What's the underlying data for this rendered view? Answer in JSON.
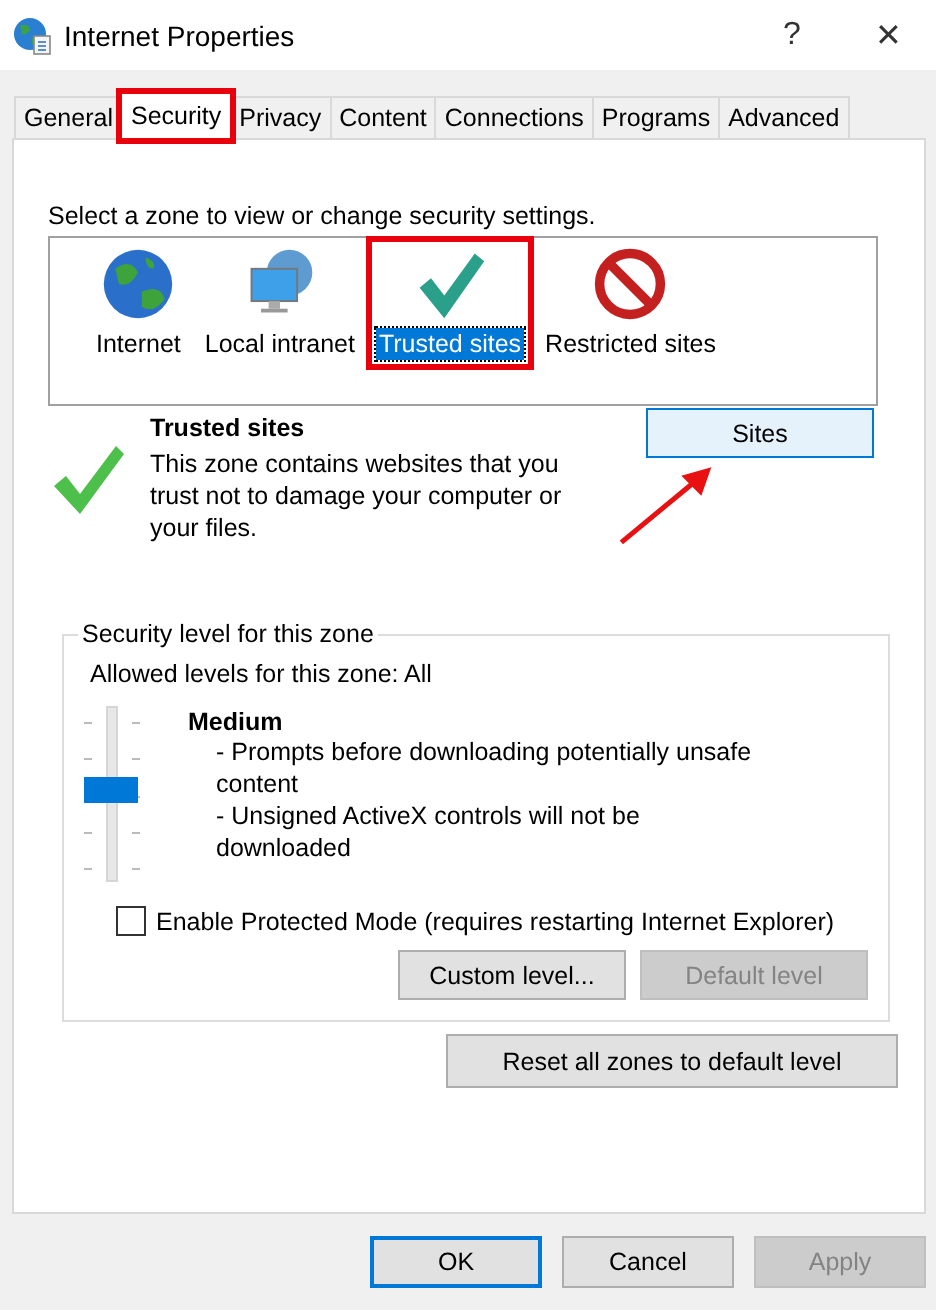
{
  "window": {
    "title": "Internet Properties",
    "help": "?",
    "close": "✕"
  },
  "tabs": [
    {
      "label": "General",
      "selected": false,
      "highlighted": false
    },
    {
      "label": "Security",
      "selected": true,
      "highlighted": true
    },
    {
      "label": "Privacy",
      "selected": false,
      "highlighted": false
    },
    {
      "label": "Content",
      "selected": false,
      "highlighted": false
    },
    {
      "label": "Connections",
      "selected": false,
      "highlighted": false
    },
    {
      "label": "Programs",
      "selected": false,
      "highlighted": false
    },
    {
      "label": "Advanced",
      "selected": false,
      "highlighted": false
    }
  ],
  "zone_prompt": "Select a zone to view or change security settings.",
  "zones": [
    {
      "kind": "globe",
      "label": "Internet",
      "selected": false,
      "highlighted": false
    },
    {
      "kind": "intranet",
      "label": "Local intranet",
      "selected": false,
      "highlighted": false
    },
    {
      "kind": "trusted",
      "label": "Trusted sites",
      "selected": true,
      "highlighted": true
    },
    {
      "kind": "restricted",
      "label": "Restricted sites",
      "selected": false,
      "highlighted": false
    }
  ],
  "zone_info": {
    "title": "Trusted sites",
    "description": "This zone contains websites that you trust not to damage your computer or your files.",
    "button": "Sites",
    "callout_arrow": true
  },
  "security_level": {
    "legend": "Security level for this zone",
    "allowed": "Allowed levels for this zone: All",
    "level": 0.5,
    "name": "Medium",
    "details": [
      "- Prompts before downloading potentially unsafe content",
      "- Unsigned ActiveX controls will not be downloaded"
    ],
    "protected_mode": {
      "label": "Enable Protected Mode (requires restarting Internet Explorer)",
      "checked": false
    },
    "buttons": [
      {
        "label": "Custom level...",
        "disabled": false
      },
      {
        "label": "Default level",
        "disabled": true
      }
    ]
  },
  "reset_button": "Reset all zones to default level",
  "footer_buttons": [
    {
      "label": "OK",
      "default": true,
      "disabled": false
    },
    {
      "label": "Cancel",
      "default": false,
      "disabled": false
    },
    {
      "label": "Apply",
      "default": false,
      "disabled": true
    }
  ]
}
